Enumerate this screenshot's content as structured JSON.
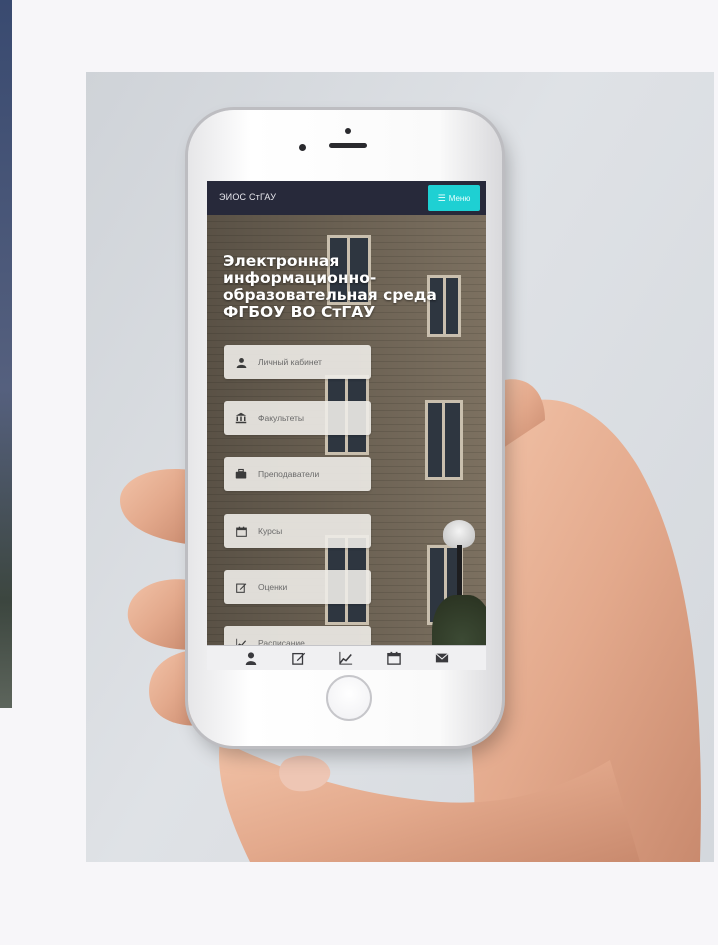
{
  "app": {
    "brand": "ЭИОС СтГАУ",
    "menu_label": "Меню"
  },
  "hero": {
    "title": "Электронная информационно-образовательная среда ФГБОУ ВО СтГАУ"
  },
  "nav": {
    "items": [
      {
        "label": "Личный кабинет",
        "icon": "user-icon"
      },
      {
        "label": "Факультеты",
        "icon": "university-icon"
      },
      {
        "label": "Преподаватели",
        "icon": "briefcase-icon"
      },
      {
        "label": "Курсы",
        "icon": "calendar-icon"
      },
      {
        "label": "Оценки",
        "icon": "edit-icon"
      },
      {
        "label": "Расписание",
        "icon": "chart-line-icon"
      }
    ]
  },
  "tabbar": {
    "icons": [
      "user-icon",
      "edit-icon",
      "chart-line-icon",
      "calendar-icon",
      "envelope-icon"
    ]
  },
  "colors": {
    "topbar": "#27293a",
    "menu_button": "#1ed0d3",
    "card_bg": "#eeece8",
    "page_bg": "#f7f6f9"
  }
}
